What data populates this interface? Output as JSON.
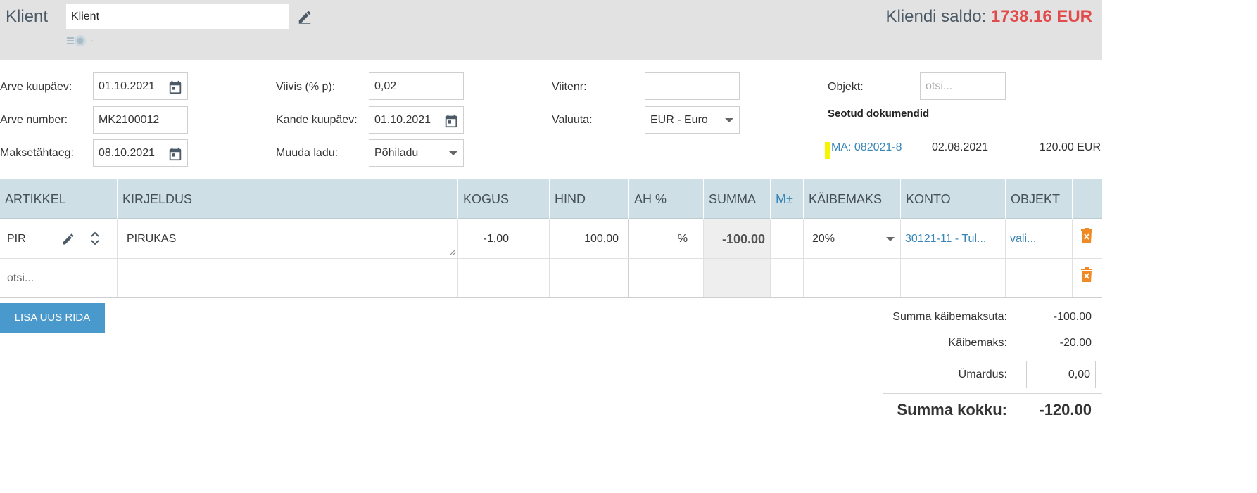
{
  "header": {
    "title": "Klient",
    "client_value": "Klient",
    "sub_text": "-",
    "saldo_label": "Kliendi saldo:",
    "saldo_amount": "1738.16 EUR"
  },
  "form": {
    "invoice_date_label": "Arve kuupäev:",
    "invoice_date": "01.10.2021",
    "invoice_number_label": "Arve number:",
    "invoice_number": "MK2100012",
    "due_date_label": "Maksetähtaeg:",
    "due_date": "08.10.2021",
    "penalty_label": "Viivis (% p):",
    "penalty": "0,02",
    "entry_date_label": "Kande kuupäev:",
    "entry_date": "01.10.2021",
    "warehouse_label": "Muuda ladu:",
    "warehouse": "Põhiladu",
    "reference_label": "Viitenr:",
    "reference": "",
    "currency_label": "Valuuta:",
    "currency": "EUR - Euro",
    "object_label": "Objekt:",
    "object_placeholder": "otsi..."
  },
  "linked_docs": {
    "title": "Seotud dokumendid",
    "items": [
      {
        "doc": "MA: 082021-8",
        "date": "02.08.2021",
        "sum": "120.00 EUR"
      }
    ]
  },
  "table": {
    "headers": [
      "ARTIKKEL",
      "KIRJELDUS",
      "KOGUS",
      "HIND",
      "AH %",
      "SUMMA",
      "M±",
      "KÄIBEMAKS",
      "KONTO",
      "OBJEKT"
    ],
    "rows": [
      {
        "article": "PIR",
        "description": "PIRUKAS",
        "quantity": "-1,00",
        "price": "100,00",
        "discount": "%",
        "sum": "-100.00",
        "vat": "20%",
        "account": "30121-11 - Tul...",
        "object": "vali..."
      }
    ],
    "new_row_placeholder": "otsi..."
  },
  "add_row_button": "LISA UUS RIDA",
  "totals": {
    "net_label": "Summa käibemaksuta:",
    "net": "-100.00",
    "vat_label": "Käibemaks:",
    "vat": "-20.00",
    "rounding_label": "Ümardus:",
    "rounding": "0,00",
    "total_label": "Summa kokku:",
    "total": "-120.00"
  },
  "colors": {
    "header_bg": "#e2e2e2",
    "table_header_bg": "#cfdfe6",
    "accent_blue": "#3a86b8",
    "saldo_red": "#e24b4b",
    "button_blue": "#4a99cc",
    "trash_orange": "#f08a24"
  },
  "icons": [
    "pencil-icon",
    "calendar-icon",
    "sort-arrows-icon",
    "trash-icon",
    "dropdown-caret-icon"
  ]
}
